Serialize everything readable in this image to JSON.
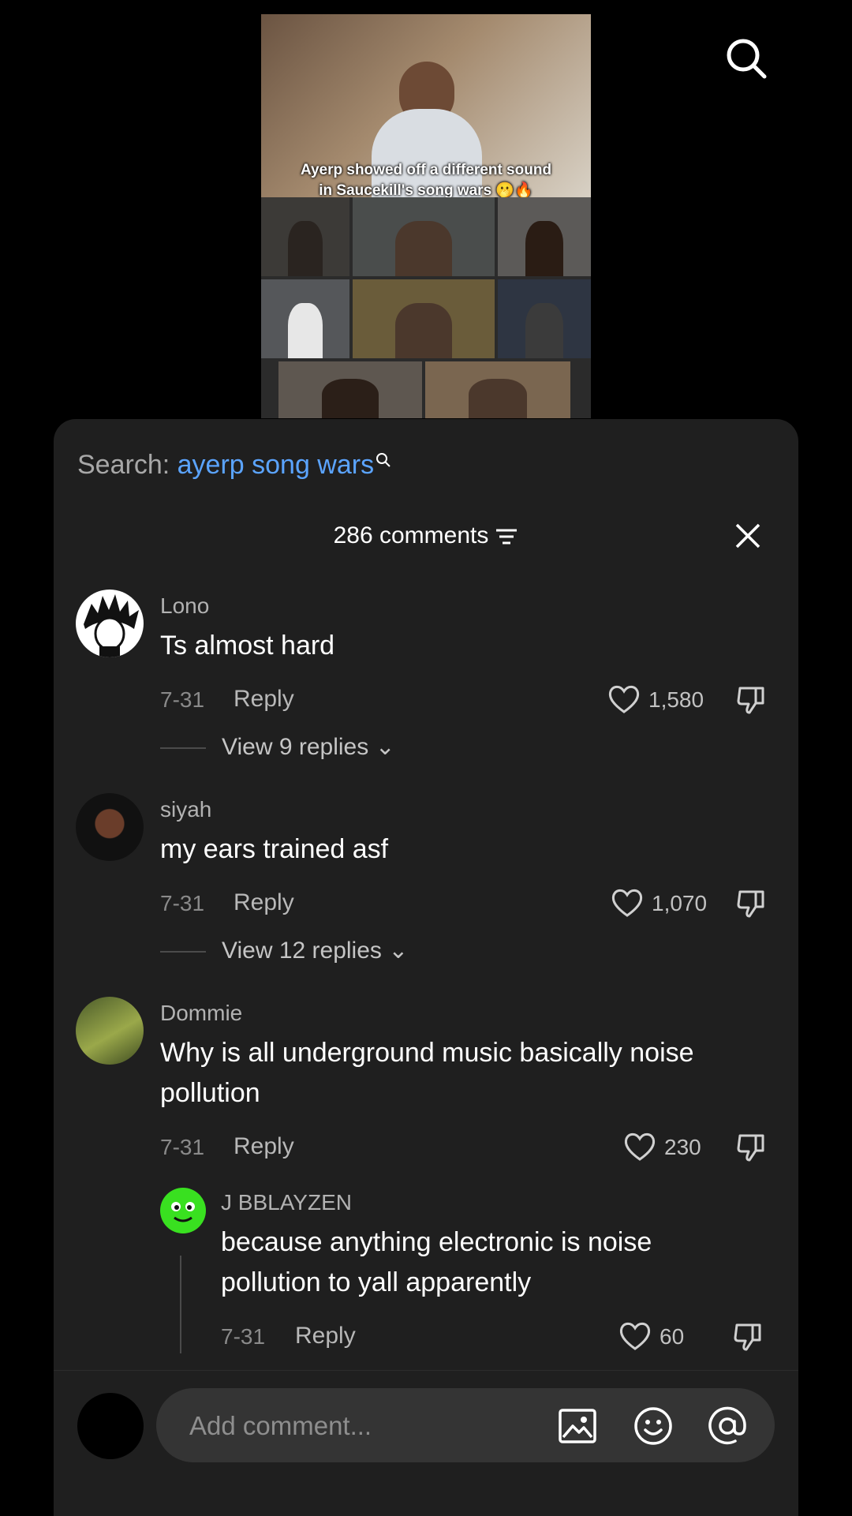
{
  "video": {
    "caption_line1": "Ayerp showed off a different sound",
    "caption_line2": "in Saucekill's song wars 🫢🔥"
  },
  "top_bar": {
    "search_icon": "search-icon"
  },
  "search_suggestion": {
    "prefix": "Search:",
    "term": "ayerp song wars"
  },
  "comments_panel": {
    "title": "286 comments",
    "sort_icon": "sort-icon",
    "close_icon": "close-icon"
  },
  "comments": [
    {
      "user": "Lono",
      "text": "Ts almost hard",
      "date": "7-31",
      "reply_label": "Reply",
      "likes": "1,580",
      "view_replies": "View 9 replies"
    },
    {
      "user": "siyah",
      "text": "my ears trained asf",
      "date": "7-31",
      "reply_label": "Reply",
      "likes": "1,070",
      "view_replies": "View 12 replies"
    },
    {
      "user": "Dommie",
      "text": "Why is all underground music basically noise pollution",
      "date": "7-31",
      "reply_label": "Reply",
      "likes": "230"
    }
  ],
  "reply": {
    "user": "J BBLAYZEN",
    "text": "because anything electronic is noise pollution to yall apparently",
    "date": "7-31",
    "reply_label": "Reply",
    "likes": "60"
  },
  "composer": {
    "placeholder": "Add comment...",
    "icons": [
      "image-icon",
      "emoji-icon",
      "mention-icon"
    ]
  },
  "colors": {
    "accent_link": "#5ba4ff",
    "sheet_bg": "#1f1f1f",
    "reply_avatar": "#39e020"
  }
}
